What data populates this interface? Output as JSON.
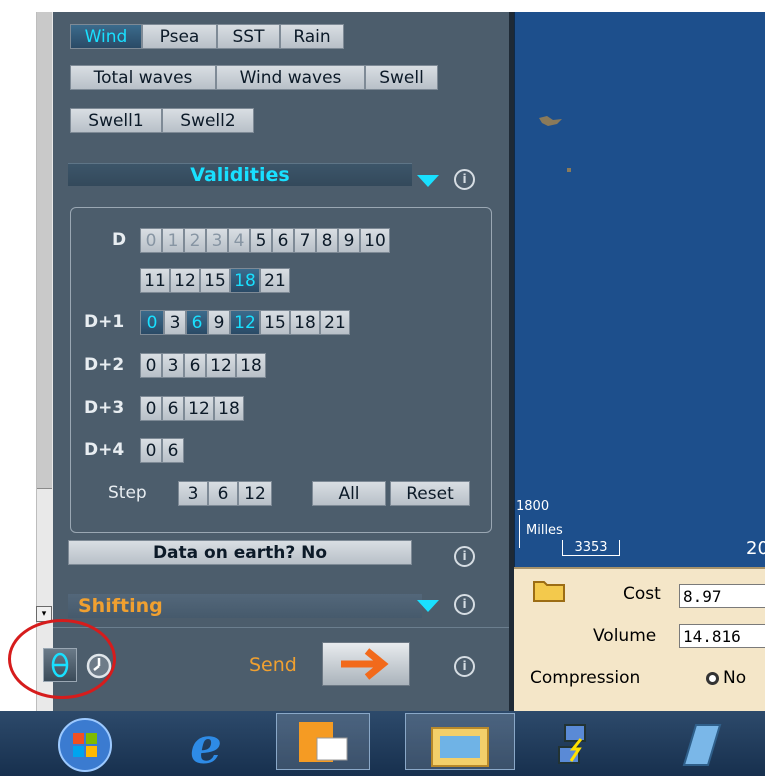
{
  "layer_tabs": [
    "Wind",
    "Psea",
    "SST",
    "Rain",
    "Total waves",
    "Wind waves",
    "Swell",
    "Swell1",
    "Swell2"
  ],
  "layer_active": "Wind",
  "validities": {
    "header": "Validities",
    "rows": [
      {
        "label": "D",
        "values": [
          "0",
          "1",
          "2",
          "3",
          "4",
          "5",
          "6",
          "7",
          "8",
          "9",
          "10",
          "11",
          "12",
          "15",
          "18",
          "21"
        ]
      },
      {
        "label": "D+1",
        "values": [
          "0",
          "3",
          "6",
          "9",
          "12",
          "15",
          "18",
          "21"
        ]
      },
      {
        "label": "D+2",
        "values": [
          "0",
          "3",
          "6",
          "12",
          "18"
        ]
      },
      {
        "label": "D+3",
        "values": [
          "0",
          "6",
          "12",
          "18"
        ]
      },
      {
        "label": "D+4",
        "values": [
          "0",
          "6"
        ]
      }
    ],
    "step_label": "Step",
    "step_values": [
      "3",
      "6",
      "12",
      "All",
      "Reset"
    ]
  },
  "data_on_earth": "Data on earth? No",
  "shifting": "Shifting",
  "send_label": "Send",
  "info_glyph": "i",
  "scroll_glyph": "▾",
  "map": {
    "scale_top": "1800",
    "scale_unit": "Milles",
    "scale_bottom": "3353",
    "lon_label": "20"
  },
  "bottom": {
    "cost_label": "Cost",
    "cost_value": "8.97",
    "volume_label": "Volume",
    "volume_value": "14.816",
    "compression_label": "Compression",
    "compression_option": "No"
  },
  "colors": {
    "panel_bg": "#4c5d6c",
    "accent_cyan": "#19e0ff",
    "orange_heading": "#f0a030",
    "map_blue": "#1d4f8c",
    "highlight_red": "#d61c1c"
  }
}
